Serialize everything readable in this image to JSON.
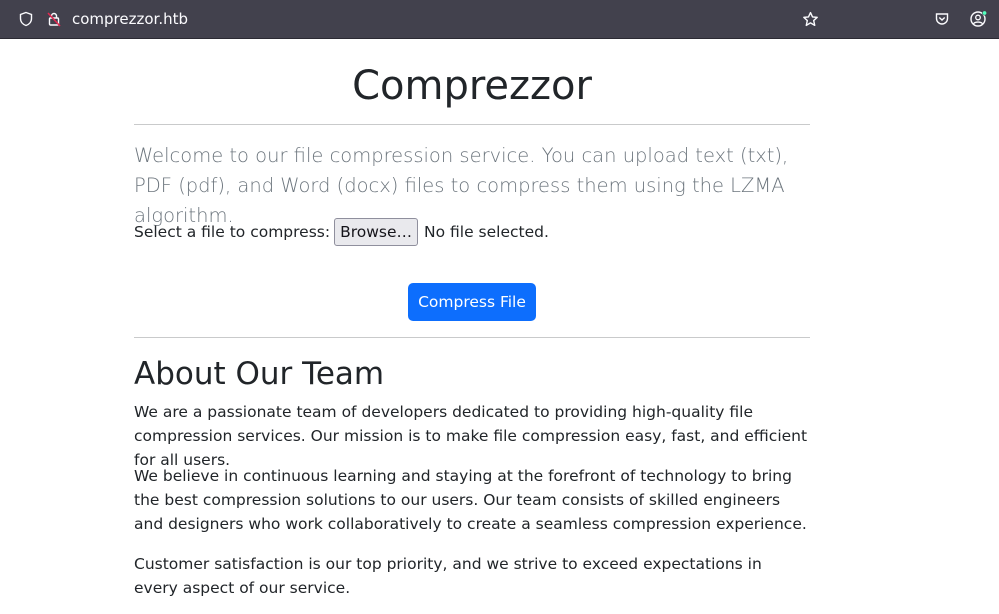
{
  "browser": {
    "url": "comprezzor.htb"
  },
  "page": {
    "title": "Comprezzor",
    "lead": "Welcome to our file compression service. You can upload text (txt), PDF (pdf), and Word (docx) files to compress them using the LZMA algorithm.",
    "file_label": "Select a file to compress:",
    "browse_label": "Browse…",
    "no_file_text": "No file selected.",
    "submit_label": "Compress File",
    "about_title": "About Our Team",
    "paragraphs": [
      "We are a passionate team of developers dedicated to providing high-quality file compression services. Our mission is to make file compression easy, fast, and efficient for all users.",
      "We believe in continuous learning and staying at the forefront of technology to bring the best compression solutions to our users. Our team consists of skilled engineers and designers who work collaboratively to create a seamless compression experience.",
      "Customer satisfaction is our top priority, and we strive to exceed expectations in every aspect of our service."
    ]
  },
  "colors": {
    "toolbar_bg": "#42414d",
    "primary_button": "#0d6efd",
    "lead_text": "#6c757d",
    "body_text": "#212529"
  },
  "icons": [
    "shield-icon",
    "lock-insecure-icon",
    "bookmark-star-icon",
    "pocket-icon",
    "account-icon"
  ]
}
